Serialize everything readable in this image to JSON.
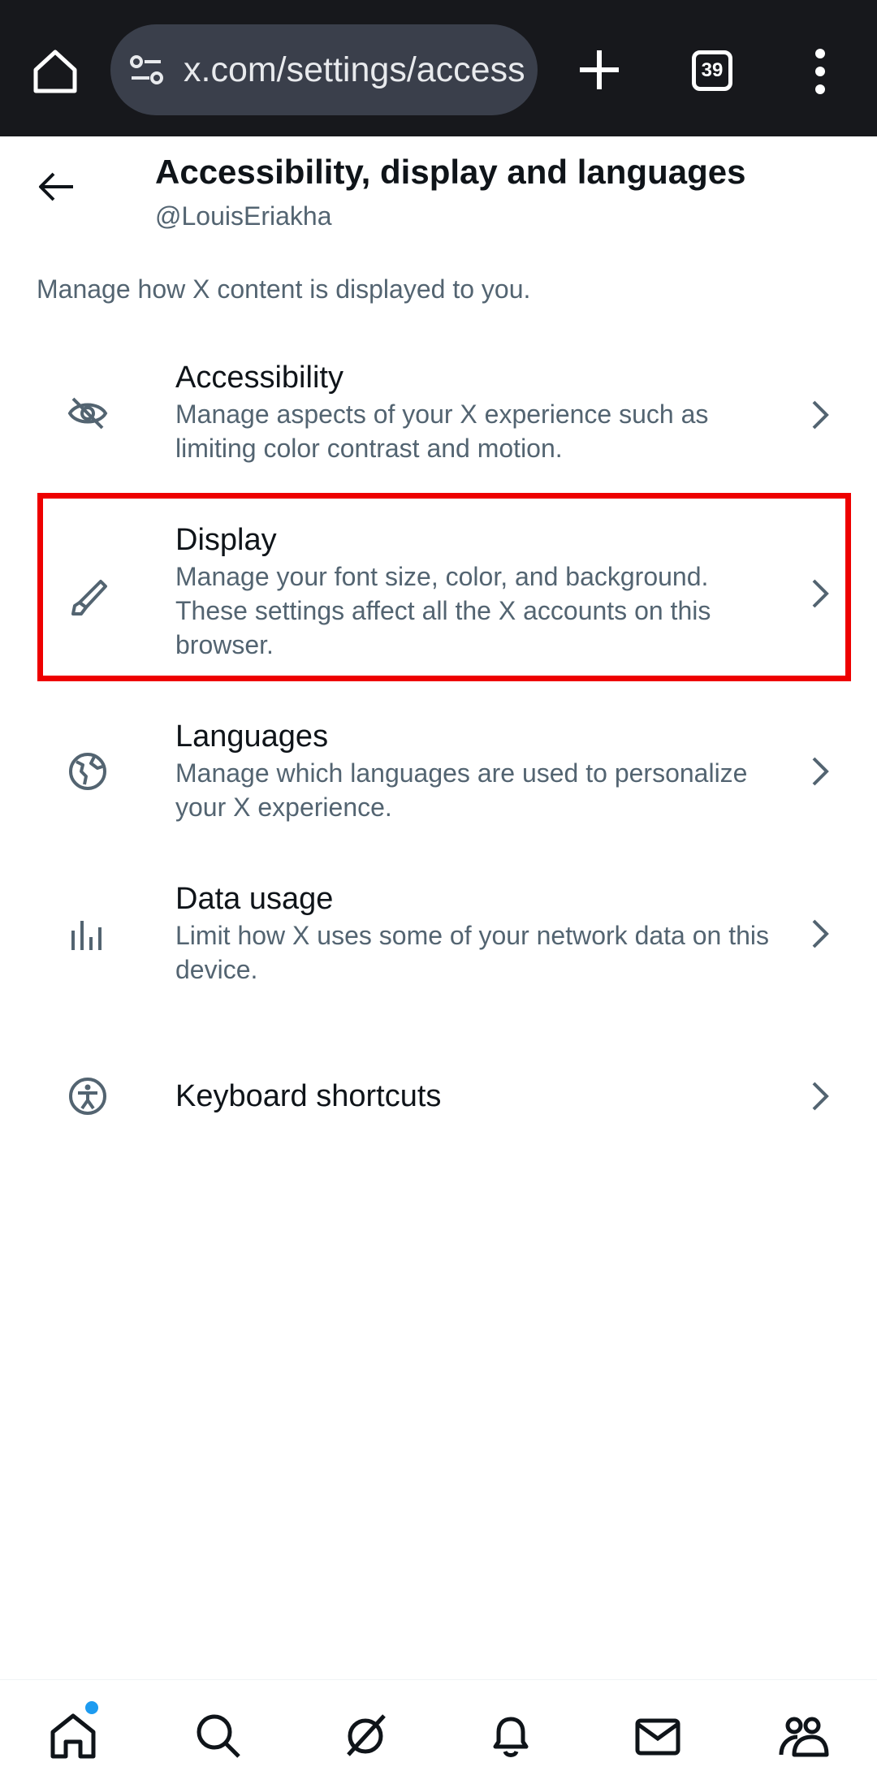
{
  "browser": {
    "url": "x.com/settings/accessibility_display_and_languages",
    "tab_count": "39"
  },
  "header": {
    "title": "Accessibility, display and languages",
    "username": "@LouisEriakha"
  },
  "intro_text": "Manage how X content is displayed to you.",
  "settings": [
    {
      "title": "Accessibility",
      "description": "Manage aspects of your X experience such as limiting color contrast and motion.",
      "icon": "eye-slash-icon"
    },
    {
      "title": "Display",
      "description": "Manage your font size, color, and background. These settings affect all the X accounts on this browser.",
      "icon": "paintbrush-icon"
    },
    {
      "title": "Languages",
      "description": "Manage which languages are used to personalize your X experience.",
      "icon": "globe-icon"
    },
    {
      "title": "Data usage",
      "description": "Limit how X uses some of your network data on this device.",
      "icon": "bar-chart-icon"
    },
    {
      "title": "Keyboard shortcuts",
      "description": "",
      "icon": "accessibility-person-icon"
    }
  ],
  "bottom_nav": [
    "home-icon",
    "search-icon",
    "grok-icon",
    "bell-icon",
    "mail-icon",
    "communities-icon"
  ],
  "colors": {
    "highlight": "#ee0000",
    "secondary_text": "#536471",
    "primary_text": "#0f1419",
    "notification_dot": "#1d9bf0",
    "browser_bar": "#17181c"
  }
}
